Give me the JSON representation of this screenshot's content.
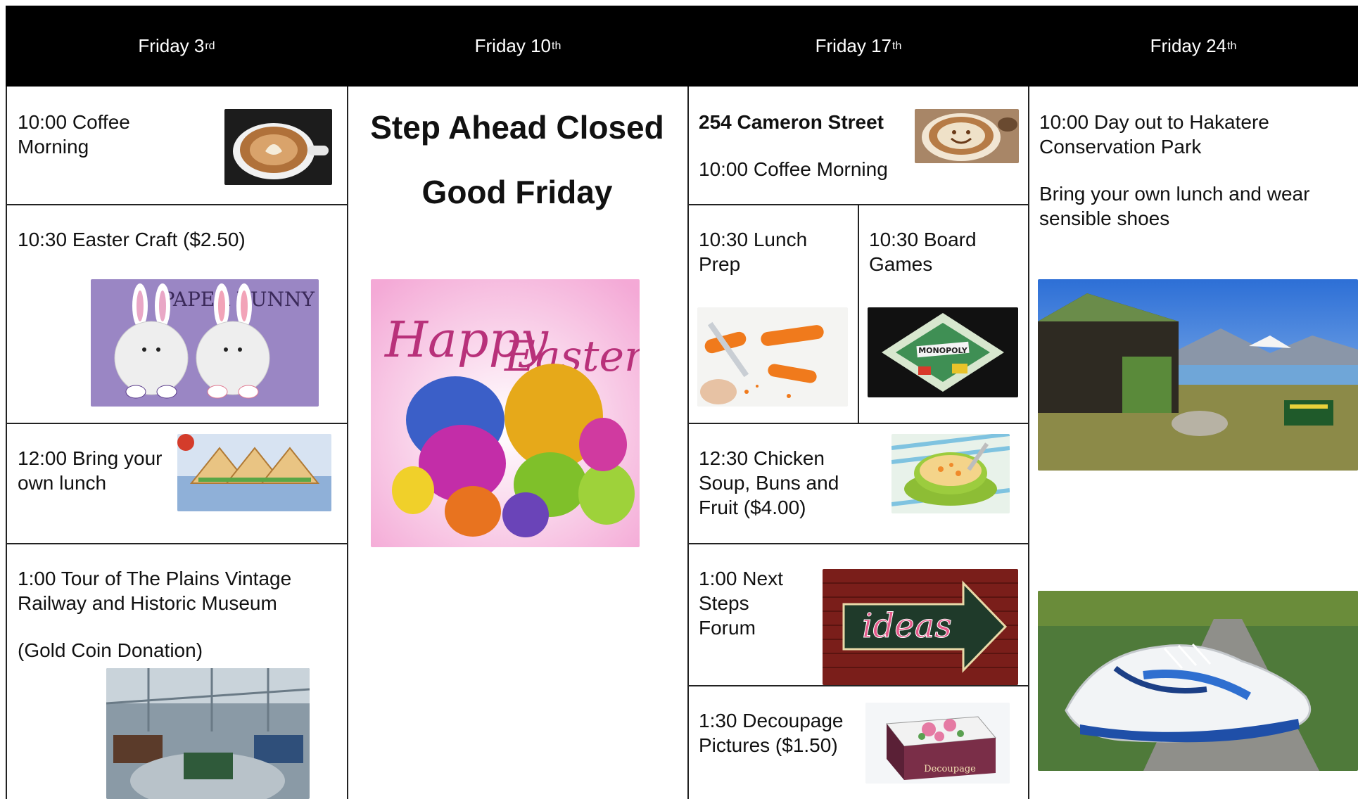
{
  "header": {
    "days": [
      {
        "label": "Friday 3",
        "suffix": "rd"
      },
      {
        "label": "Friday 10",
        "suffix": "th"
      },
      {
        "label": "Friday 17",
        "suffix": "th"
      },
      {
        "label": "Friday 24",
        "suffix": "th"
      }
    ]
  },
  "col1": {
    "coffee": "10:00 Coffee Morning",
    "easter_craft": "10:30 Easter Craft ($2.50)",
    "paper_bunny_text": "PAPER BUNNY",
    "lunch": "12:00 Bring your own lunch",
    "tour": "1:00 Tour of The Plains Vintage Railway and Historic Museum",
    "donation": "(Gold Coin Donation)"
  },
  "col2": {
    "closed": "Step Ahead Closed",
    "good_friday": "Good Friday",
    "happy": "Happy",
    "easter": "Easter"
  },
  "col3": {
    "address": "254 Cameron Street",
    "coffee": "10:00 Coffee Morning",
    "lunch_prep": "10:30 Lunch Prep",
    "board_games": "10:30 Board Games",
    "monopoly_text": "MONOPOLY",
    "soup": "12:30 Chicken Soup, Buns and Fruit ($4.00)",
    "forum": "1:00 Next Steps Forum",
    "ideas_text": "ideas",
    "decoupage": "1:30 Decoupage Pictures ($1.50)",
    "decoupage_box_text": "Decoupage"
  },
  "col4": {
    "day_out": "10:00 Day out to Hakatere Conservation Park",
    "bring_lunch": "Bring your own lunch and wear sensible shoes"
  },
  "colors": {
    "header_bg": "#000000",
    "header_text": "#ffffff",
    "grid": "#222222"
  }
}
